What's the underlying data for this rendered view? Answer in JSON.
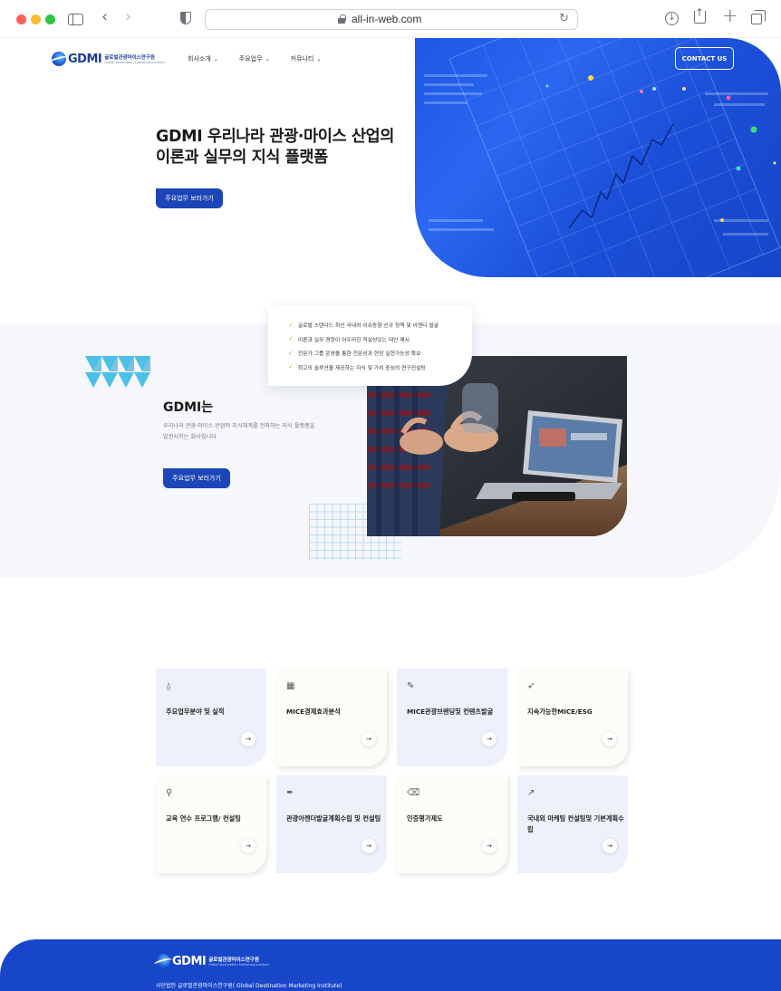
{
  "browser": {
    "url": "all-in-web.com",
    "icons": [
      "sidebar-icon",
      "back-icon",
      "forward-icon",
      "shield-icon",
      "lock-icon",
      "reload-icon",
      "download-icon",
      "share-icon",
      "new-tab-icon",
      "tabs-icon"
    ]
  },
  "header": {
    "logo_text": "GDMI",
    "logo_sub_ko": "글로벌관광마이스연구원",
    "logo_sub_en": "Global Destination Marketing Institute",
    "nav": [
      {
        "label": "회사소개"
      },
      {
        "label": "주요업무"
      },
      {
        "label": "커뮤니티"
      }
    ],
    "contact_label": "CONTACT US"
  },
  "hero": {
    "title_line1": "GDMI 우리나라 관광·마이스 산업의",
    "title_line2": "이론과 실무의 지식 플랫폼",
    "button_label": "주요업무 보러가기"
  },
  "about": {
    "checklist": [
      "글로벌 스탠다드 최신 국내외 이슈동향 신규 정책 및 아젠다 발굴",
      "이론과 실무 경험이 어우러진 적실성있는 대안 제시",
      "전문가 그룹 운영을 통한 전문성과 현장 실현가능성 확보",
      "최고의 솔루션을 제공하는 지식 및 가치 중심의 연구컨설팅"
    ],
    "title": "GDMI는",
    "desc_line1": "우리나라 관광·마이스 산업의 지식체계를 전파하는 지식 플랫폼을",
    "desc_line2": "발전시키는 회사입니다",
    "button_label": "주요업무 보러가기"
  },
  "services": {
    "cards": [
      {
        "icon": "rocket-icon",
        "glyph": "⍙",
        "title": "주요업무분야 및 실적",
        "style": "blue"
      },
      {
        "icon": "calculator-icon",
        "glyph": "▦",
        "title": "MICE경제효과분석",
        "style": "white"
      },
      {
        "icon": "tag-icon",
        "glyph": "✎",
        "title": "MICE관광브랜딩및 컨텐츠발굴",
        "style": "blue"
      },
      {
        "icon": "send-icon",
        "glyph": "➶",
        "title": "지속가능한MICE/ESG",
        "style": "white"
      },
      {
        "icon": "route-icon",
        "glyph": "⚲",
        "title": "교육 연수 프로그램/ 컨설팅",
        "style": "white"
      },
      {
        "icon": "pen-icon",
        "glyph": "✒",
        "title": "관광아젠더발굴계획수립 및 컨설팅",
        "style": "blue"
      },
      {
        "icon": "eraser-icon",
        "glyph": "⌫",
        "title": "인증평가제도",
        "style": "white"
      },
      {
        "icon": "chart-line-icon",
        "glyph": "↗",
        "title": "국내외 마케팅 컨설팅및 기본계획수립",
        "style": "blue"
      }
    ],
    "arrow": "→"
  },
  "footer": {
    "logo_text": "GDMI",
    "logo_sub_ko": "글로벌관광마이스연구원",
    "logo_sub_en": "Global Destination Marketing Institute",
    "org_name": "사단법인 글로벌관광마이스연구원( Global Destination Marketing Institute)"
  },
  "colors": {
    "brand_blue": "#1c45b8",
    "hero_blue": "#1d57e6",
    "check_orange": "#f2a533",
    "triangle_cyan": "#4cc0e6"
  }
}
